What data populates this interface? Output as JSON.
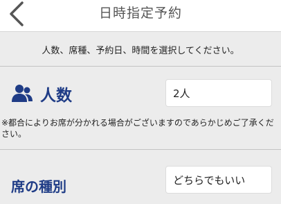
{
  "header": {
    "title": "日時指定予約",
    "back_icon": "chevron-left-icon"
  },
  "instruction": "人数、席種、予約日、時間を選択してください。",
  "party_size": {
    "icon": "people-icon",
    "label": "人数",
    "value": "2人"
  },
  "note": "※都合によりお席が分かれる場合がございますのであらかじめご了承ください。",
  "seat_type": {
    "label": "席の種別",
    "value": "どちらでもいい"
  },
  "colors": {
    "accent": "#1f3c86",
    "background": "#ececec"
  }
}
